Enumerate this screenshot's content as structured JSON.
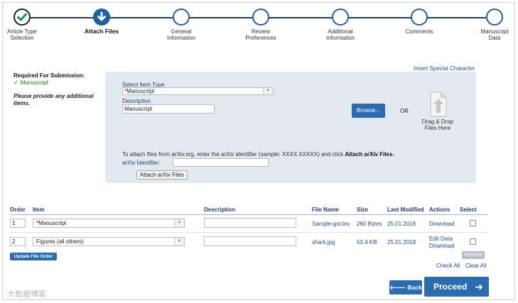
{
  "steps": [
    {
      "label": "Article Type\nSelection",
      "state": "done"
    },
    {
      "label": "Attach Files",
      "state": "active"
    },
    {
      "label": "General\nInformation",
      "state": "todo"
    },
    {
      "label": "Review\nPreferences",
      "state": "todo"
    },
    {
      "label": "Additional\nInformation",
      "state": "todo"
    },
    {
      "label": "Comments",
      "state": "todo"
    },
    {
      "label": "Manuscript\nData",
      "state": "todo"
    }
  ],
  "requirements": {
    "title": "Required For Submission:",
    "items": [
      "Manuscript"
    ],
    "note": "Please provide any additional items."
  },
  "special_char_link": "Insert Special Character",
  "upload": {
    "item_type_label": "Select Item Type",
    "item_type_value": "*Manuscript",
    "description_label": "Description",
    "description_value": "Manuscript",
    "browse_label": "Browse...",
    "or_label": "OR",
    "dnd_label": "Drag & Drop Files Here",
    "arxiv_instruction_pre": "To attach files from arXiv.org, enter the arXiv identifier (sample: XXXX.XXXXX) and click ",
    "arxiv_instruction_bold": "Attach arXiv Files.",
    "arxiv_id_label": "arXiv Identifier:",
    "arxiv_id_value": "",
    "attach_arxiv_label": "Attach arXiv Files"
  },
  "table": {
    "headers": {
      "order": "Order",
      "item": "Item",
      "description": "Description",
      "file_name": "File Name",
      "size": "Size",
      "last_modified": "Last Modified",
      "actions": "Actions",
      "select": "Select"
    },
    "rows": [
      {
        "order": "1",
        "item": "*Manuscript",
        "description": "",
        "file_name": "Sample-gst.tex",
        "size": "260 Bytes",
        "last_modified": "25.01.2018",
        "actions": [
          "Download"
        ]
      },
      {
        "order": "2",
        "item": "Figures (all others)",
        "description": "",
        "file_name": "shark.jpg",
        "size": "50.4 KB",
        "last_modified": "25.01.2018",
        "actions": [
          "Edit Data",
          "Download"
        ]
      }
    ]
  },
  "controls": {
    "update_order": "Update File Order",
    "remove": "Remove",
    "check_all": "Check All",
    "clear_all": "Clear All",
    "back": "Back",
    "proceed": "Proceed"
  },
  "watermark": "大数据博客",
  "colors": {
    "accent": "#2b6cb0",
    "done": "#1a9a3a",
    "panel": "#e3e9f1"
  }
}
